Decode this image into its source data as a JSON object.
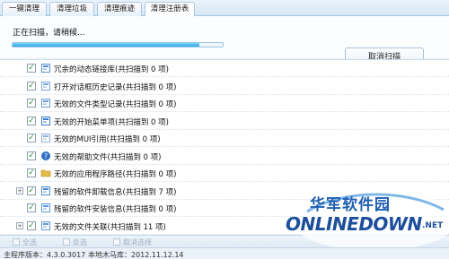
{
  "tabs": [
    {
      "label": "一键清理"
    },
    {
      "label": "清理垃圾"
    },
    {
      "label": "清理痕迹"
    },
    {
      "label": "清理注册表"
    }
  ],
  "scan": {
    "status": "正在扫描，请稍候...",
    "progress": 0.89,
    "cancel_label": "取消扫描"
  },
  "items": [
    {
      "label": "冗余的动态链接库(共扫描到 0 项)",
      "icon": "dll-icon"
    },
    {
      "label": "打开对话框历史记录(共扫描到 0 项)",
      "icon": "dialog-icon"
    },
    {
      "label": "无效的文件类型记录(共扫描到 0 项)",
      "icon": "filetype-icon"
    },
    {
      "label": "无效的开始菜单项(共扫描到 0 项)",
      "icon": "startmenu-icon"
    },
    {
      "label": "无效的MUI引用(共扫描到 0 项)",
      "icon": "mui-icon"
    },
    {
      "label": "无效的帮助文件(共扫描到 0 项)",
      "icon": "help-icon"
    },
    {
      "label": "无效的应用程序路径(共扫描到 0 项)",
      "icon": "folder-icon"
    },
    {
      "label": "残留的软件卸载信息(共扫描到 7 项)",
      "icon": "uninstall-icon",
      "expandable": true
    },
    {
      "label": "残留的软件安装信息(共扫描到 0 项)",
      "icon": "install-icon"
    },
    {
      "label": "无效的文件关联(共扫描到 11 项)",
      "icon": "association-icon",
      "expandable": true
    }
  ],
  "bottom_tools": [
    "全选",
    "反选",
    "取消选择"
  ],
  "statusbar": {
    "version": "主程序版本：4.3.0.3017",
    "db": "本地木马库：2012.11.12.14"
  },
  "watermark": {
    "cn": "华军软件园",
    "en": "ONLINEDOWN",
    "suffix": ".NET"
  },
  "colors": {
    "accent": "#2fa8e6",
    "check": "#2a8a2a",
    "watermark": "#1d4f9b"
  }
}
